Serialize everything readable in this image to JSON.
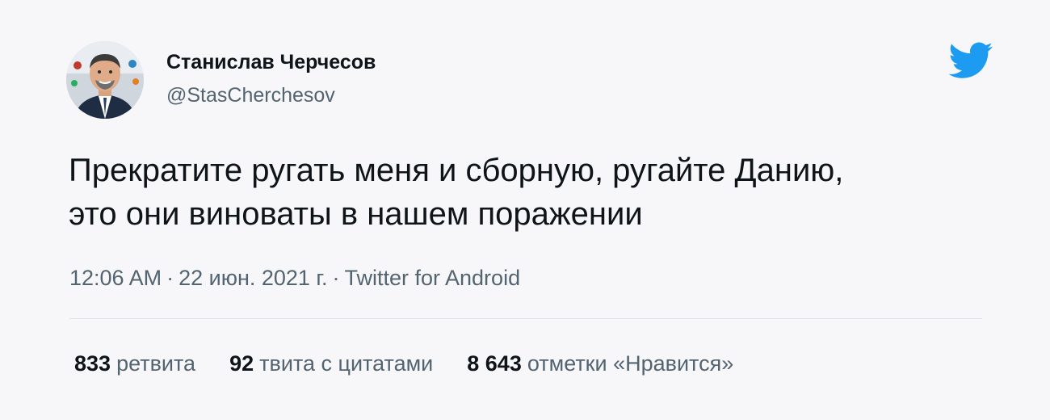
{
  "author": {
    "display_name": "Станислав Черчесов",
    "handle": "@StasCherchesov"
  },
  "tweet": {
    "lines": [
      "Прекратите ругать меня и сборную, ругайте Данию,",
      "это они виноваты в нашем поражении"
    ],
    "time": "12:06 AM",
    "date": "22 июн. 2021 г.",
    "source": "Twitter for Android",
    "separator": "·"
  },
  "stats": [
    {
      "count": "833",
      "label": "ретвита"
    },
    {
      "count": "92",
      "label": "твита с цитатами"
    },
    {
      "count": "8 643",
      "label": "отметки «Нравится»"
    }
  ],
  "icons": {
    "logo": "twitter-bird-icon",
    "avatar": "user-avatar"
  },
  "colors": {
    "twitter_blue": "#1d9bf0",
    "background": "#f7f7f9",
    "text_primary": "#0f1419",
    "text_secondary": "#536471"
  }
}
